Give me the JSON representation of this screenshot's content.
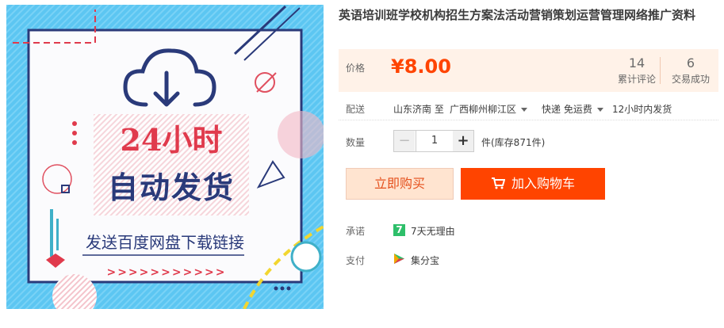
{
  "product": {
    "title": "英语培训班学校机构招生方案法活动营销策划运营管理网络推广资料",
    "image": {
      "line1": "24小时",
      "line2": "自动发货",
      "line3": "发送百度网盘下载链接",
      "arrows": ">>>>>>>>>>>"
    }
  },
  "price": {
    "label": "价格",
    "value": "¥8.00",
    "reviews_count": "14",
    "reviews_label": "累计评论",
    "sales_count": "6",
    "sales_label": "交易成功"
  },
  "shipping": {
    "label": "配送",
    "from": "山东济南 至",
    "to": "广西柳州柳江区",
    "method": "快递 免运费",
    "time": "12小时内发货"
  },
  "quantity": {
    "label": "数量",
    "minus": "−",
    "value": "1",
    "plus": "+",
    "stock": "件(库存871件)"
  },
  "actions": {
    "buy_now": "立即购买",
    "add_to_cart": "加入购物车"
  },
  "promise": {
    "label": "承诺",
    "icon_text": "7",
    "text": "7天无理由"
  },
  "payment": {
    "label": "支付",
    "text": "集分宝"
  },
  "colors": {
    "accent": "#ff4400",
    "price_bg": "#fff2e8",
    "image_bg": "#5cc6f2",
    "promise_green": "#2ebf6a"
  }
}
